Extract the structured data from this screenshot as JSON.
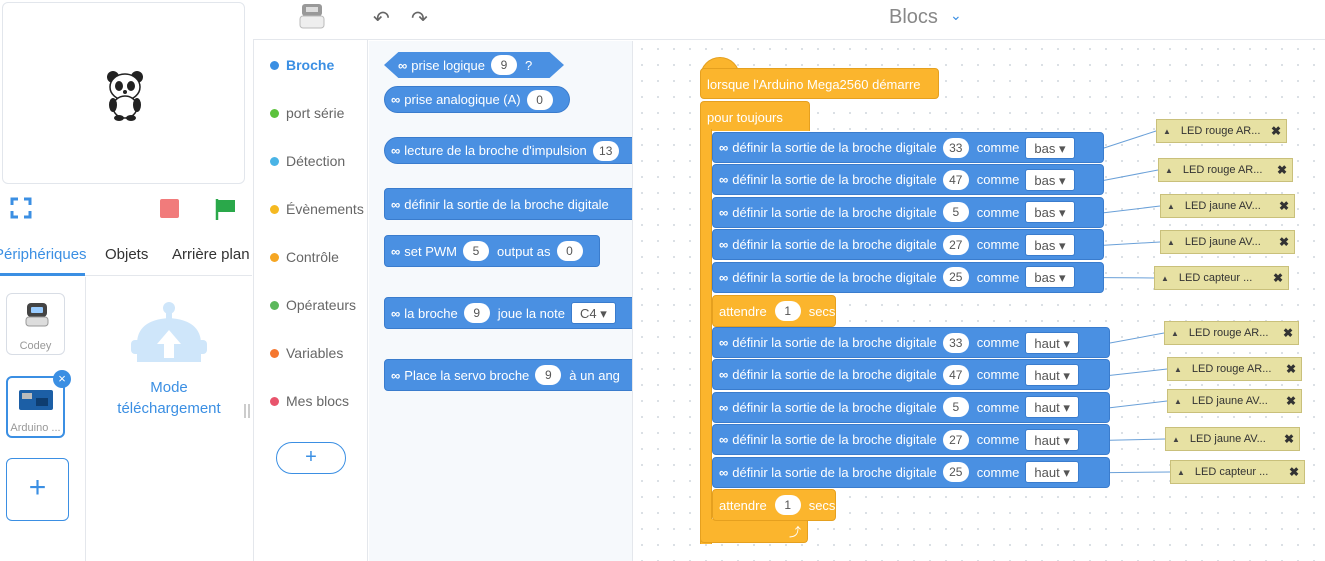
{
  "header": {
    "title": "Blocs",
    "undo_icon": "undo-icon",
    "redo_icon": "redo-icon"
  },
  "tabs": [
    {
      "label": "Périphériques"
    },
    {
      "label": "Objets"
    },
    {
      "label": "Arrière plan"
    }
  ],
  "devices": [
    {
      "label": "Codey"
    },
    {
      "label": "Arduino ..."
    }
  ],
  "upload_mode": {
    "label": "Mode téléchargement"
  },
  "categories": [
    {
      "label": "Broche",
      "color": "#3b8fe3"
    },
    {
      "label": "port série",
      "color": "#5cc23c"
    },
    {
      "label": "Détection",
      "color": "#4ab4e6"
    },
    {
      "label": "Évènements",
      "color": "#f5b921"
    },
    {
      "label": "Contrôle",
      "color": "#f5a623"
    },
    {
      "label": "Opérateurs",
      "color": "#5cb85c"
    },
    {
      "label": "Variables",
      "color": "#f5772f"
    },
    {
      "label": "Mes blocs",
      "color": "#e8546c"
    }
  ],
  "add_extension": "+",
  "palette": {
    "prise_logique": {
      "label": "prise logique",
      "pin": "9",
      "suffix": "?"
    },
    "prise_analogique": {
      "label": "prise analogique (A)",
      "pin": "0"
    },
    "lecture_impulsion": {
      "label": "lecture de la broche d'impulsion",
      "pin": "13"
    },
    "definir_sortie": {
      "label": "définir la sortie de la broche digitale"
    },
    "set_pwm": {
      "label1": "set PWM",
      "pin": "5",
      "label2": "output as",
      "value": "0"
    },
    "joue_note": {
      "label1": "la broche",
      "pin": "9",
      "label2": "joue la note",
      "note": "C4"
    },
    "servo": {
      "label1": "Place la servo broche",
      "pin": "9",
      "label2": "à un ang"
    }
  },
  "script": {
    "hat": "lorsque l'Arduino Mega2560 démarre",
    "forever": "pour toujours",
    "set_label": "définir la sortie de la broche digitale",
    "as_label": "comme",
    "wait_label": "attendre",
    "wait_value": "1",
    "wait_unit": "secs",
    "group1": [
      {
        "pin": "33",
        "level": "bas",
        "comment": "LED rouge AR..."
      },
      {
        "pin": "47",
        "level": "bas",
        "comment": "LED rouge AR..."
      },
      {
        "pin": "5",
        "level": "bas",
        "comment": "LED jaune AV..."
      },
      {
        "pin": "27",
        "level": "bas",
        "comment": "LED jaune AV..."
      },
      {
        "pin": "25",
        "level": "bas",
        "comment": "LED capteur ..."
      }
    ],
    "group2": [
      {
        "pin": "33",
        "level": "haut",
        "comment": "LED rouge AR..."
      },
      {
        "pin": "47",
        "level": "haut",
        "comment": "LED rouge AR..."
      },
      {
        "pin": "5",
        "level": "haut",
        "comment": "LED jaune AV..."
      },
      {
        "pin": "27",
        "level": "haut",
        "comment": "LED jaune AV..."
      },
      {
        "pin": "25",
        "level": "haut",
        "comment": "LED capteur ..."
      }
    ]
  }
}
